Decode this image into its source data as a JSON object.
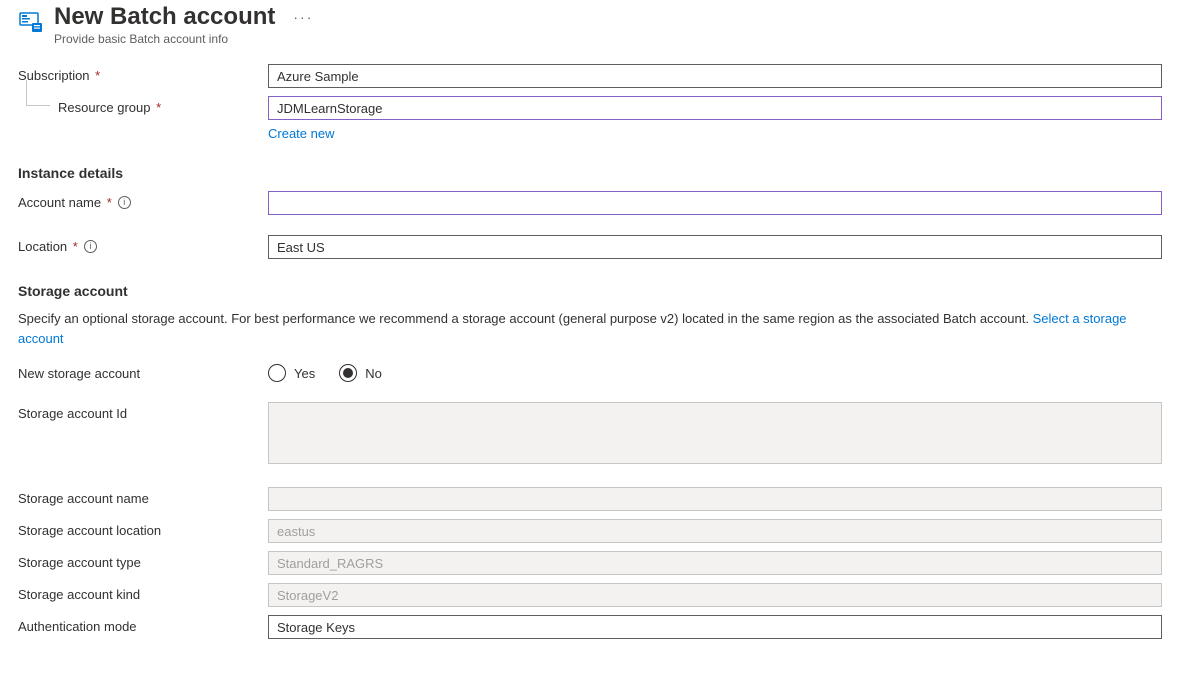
{
  "header": {
    "title": "New Batch account",
    "subtitle": "Provide basic Batch account info",
    "ellipsis": "···"
  },
  "fields": {
    "subscription": {
      "label": "Subscription",
      "value": "Azure Sample"
    },
    "resourceGroup": {
      "label": "Resource group",
      "value": "JDMLearnStorage",
      "createNew": "Create new"
    },
    "instanceDetails": "Instance details",
    "accountName": {
      "label": "Account name",
      "value": ""
    },
    "location": {
      "label": "Location",
      "value": "East US"
    },
    "storageAccountSection": "Storage account",
    "storageDesc": "Specify an optional storage account. For best performance we recommend a storage account (general purpose v2) located in the same region as the associated Batch account. ",
    "selectStorageLink": "Select a storage account",
    "newStorage": {
      "label": "New storage account",
      "yes": "Yes",
      "no": "No"
    },
    "storageId": {
      "label": "Storage account Id",
      "value": ""
    },
    "storageName": {
      "label": "Storage account name",
      "value": ""
    },
    "storageLocation": {
      "label": "Storage account location",
      "value": "eastus"
    },
    "storageType": {
      "label": "Storage account type",
      "value": "Standard_RAGRS"
    },
    "storageKind": {
      "label": "Storage account kind",
      "value": "StorageV2"
    },
    "authMode": {
      "label": "Authentication mode",
      "value": "Storage Keys"
    }
  }
}
